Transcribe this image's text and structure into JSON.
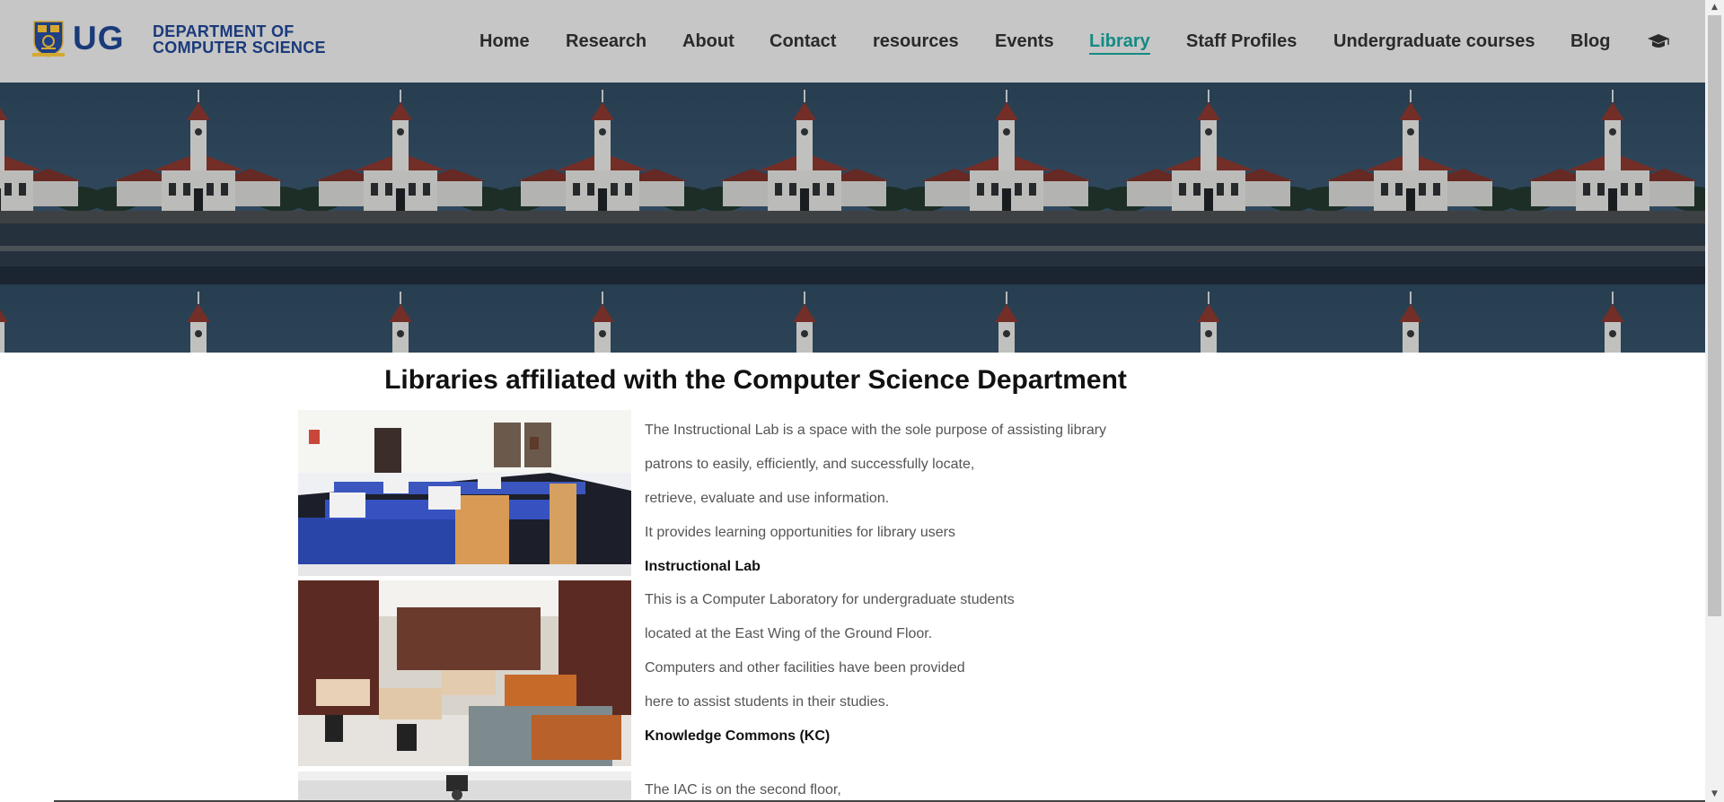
{
  "logo": {
    "short": "UG",
    "line1": "DEPARTMENT OF",
    "line2": "COMPUTER SCIENCE"
  },
  "nav": {
    "items": [
      {
        "label": "Home"
      },
      {
        "label": "Research"
      },
      {
        "label": "About"
      },
      {
        "label": "Contact"
      },
      {
        "label": "resources"
      },
      {
        "label": "Events"
      },
      {
        "label": "Library",
        "active": true
      },
      {
        "label": "Staff Profiles"
      },
      {
        "label": "Undergraduate courses"
      },
      {
        "label": "Blog"
      }
    ],
    "end_icon": "graduation-cap-icon"
  },
  "main": {
    "title": "Libraries affiliated with the Computer Science Department",
    "lines": [
      {
        "text": "The Instructional Lab is a space with the sole purpose of assisting library"
      },
      {
        "text": "patrons to easily, efficiently, and successfully locate,"
      },
      {
        "text": "retrieve, evaluate and use information."
      },
      {
        "text": "It provides learning opportunities for library users"
      },
      {
        "text": "Instructional Lab",
        "heading": true
      },
      {
        "text": "This is a Computer Laboratory for undergraduate students"
      },
      {
        "text": "located at the East Wing of the Ground Floor."
      },
      {
        "text": "Computers and other facilities have been provided"
      },
      {
        "text": "here to assist students in their studies."
      },
      {
        "text": "Knowledge Commons (KC)",
        "heading": true
      },
      {
        "text": "The IAC is on the second floor,"
      }
    ]
  },
  "colors": {
    "header_bg": "#c6c6c6",
    "brand_blue": "#1a3a7a",
    "accent_teal": "#138a84",
    "banner_sky": "#2f3e4c"
  }
}
